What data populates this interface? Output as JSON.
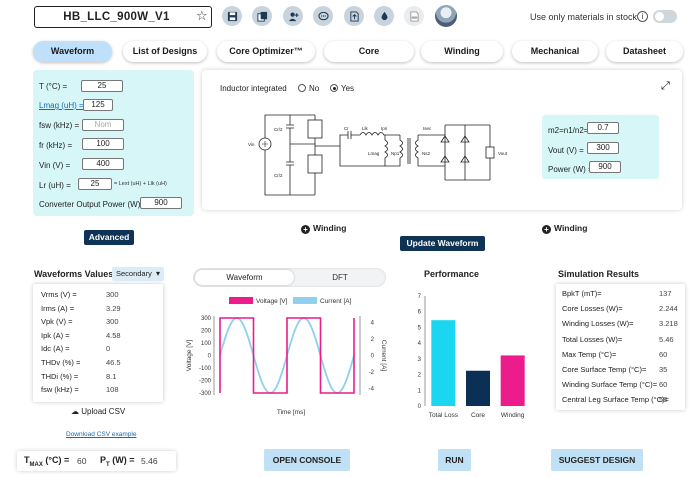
{
  "header": {
    "design_name": "HB_LLC_900W_V1",
    "stock_label": "Use only materials in stock",
    "stock_toggle_on": false,
    "toolbar_icons": [
      "save-icon",
      "copy-icon",
      "add-user-icon",
      "comment-icon",
      "export-icon",
      "drop-icon",
      "pdf-icon"
    ]
  },
  "tabs": [
    "Waveform",
    "List of Designs",
    "Core Optimizer™",
    "Core",
    "Winding",
    "Mechanical",
    "Datasheet"
  ],
  "active_tab": "Waveform",
  "params": {
    "t_label": "T (°C) =",
    "t_value": "25",
    "lmag_label": "Lmag (uH) =",
    "lmag_value": "125",
    "fsw_label": "fsw (kHz) =",
    "fsw_placeholder": "Nom",
    "fr_label": "fr (kHz) =",
    "fr_value": "100",
    "vin_label": "Vin (V) =",
    "vin_value": "400",
    "lr_label": "Lr (uH) =",
    "lr_value": "25",
    "lr_note": "= Lext (uH) + Llk (uH)",
    "pout_label": "Converter Output Power (W) =",
    "pout_value": "900",
    "advanced_label": "Advanced"
  },
  "schematic": {
    "inductor_label": "Inductor integrated",
    "no_label": "No",
    "yes_label": "Yes",
    "labels": {
      "vin": "Vin",
      "cr2a": "Cr/2",
      "cr2b": "Cr/2",
      "cr": "Cr",
      "llk": "Llk",
      "ipri": "Ipri",
      "lmag": "Lmag",
      "np1": "Np1",
      "isec": "Isec",
      "ns2": "Ns2",
      "vout": "Vout"
    },
    "ratio_label": "m2=n1/n2=",
    "ratio_value": "0.7",
    "vout_label": "Vout (V) =",
    "vout_value": "300",
    "power_label": "Power (W) =",
    "power_value": "900"
  },
  "winding_links": [
    "Winding",
    "Winding"
  ],
  "update_label": "Update Waveform",
  "waveform_values": {
    "title": "Waveforms Values",
    "selector": "Secondary",
    "rows": [
      {
        "label": "Vrms (V) =",
        "value": "300"
      },
      {
        "label": "Irms (A) =",
        "value": "3.29"
      },
      {
        "label": "Vpk (V) =",
        "value": "300"
      },
      {
        "label": "Ipk (A) =",
        "value": "4.58"
      },
      {
        "label": "Idc (A) =",
        "value": "0"
      },
      {
        "label": "THDv (%) =",
        "value": "46.5"
      },
      {
        "label": "THDi (%) =",
        "value": "8.1"
      },
      {
        "label": "fsw (kHz) =",
        "value": "108"
      }
    ],
    "upload_label": "Upload CSV",
    "download_label": "Download CSV example"
  },
  "view_toggle": {
    "waveform": "Waveform",
    "dft": "DFT"
  },
  "chart_data": [
    {
      "type": "line",
      "title": "",
      "legend": [
        "Voltage [V]",
        "Current [A]"
      ],
      "legend_position": "top",
      "xlabel": "Time [ms]",
      "ylabel": "Voltage [V]",
      "y2label": "Current [A]",
      "ylim": [
        -300,
        300
      ],
      "y2lim": [
        -4.58,
        4.58
      ],
      "yticks": [
        "300",
        "200",
        "100",
        "0",
        "-100",
        "-200",
        "-300"
      ],
      "y2ticks": [
        "4",
        "2",
        "0",
        "-2",
        "-4"
      ],
      "series": [
        {
          "name": "Voltage [V]",
          "color": "#ec1c8c",
          "shape": "square",
          "periods": 2,
          "amplitude": 300
        },
        {
          "name": "Current [A]",
          "color": "#8fd0ee",
          "shape": "sine",
          "periods": 2,
          "amplitude": 4.58
        }
      ]
    },
    {
      "type": "bar",
      "title": "Performance",
      "categories": [
        "Total Loss",
        "Core",
        "Winding"
      ],
      "values": [
        5.46,
        2.244,
        3.218
      ],
      "colors": [
        "#1ad6f0",
        "#0c2f55",
        "#ec1c8c"
      ],
      "ylim": [
        0,
        7
      ],
      "yticks": [
        "0",
        "1",
        "2",
        "3",
        "4",
        "5",
        "6",
        "7"
      ]
    }
  ],
  "simulation": {
    "title": "Simulation Results",
    "rows": [
      {
        "label": "BpkT (mT)=",
        "value": "137"
      },
      {
        "label": "Core Losses (W)=",
        "value": "2.244"
      },
      {
        "label": "Winding Losses (W)=",
        "value": "3.218"
      },
      {
        "label": "Total Losses (W)=",
        "value": "5.46"
      },
      {
        "label": "Max Temp (°C)=",
        "value": "60"
      },
      {
        "label": "Core Surface Temp (°C)=",
        "value": "35"
      },
      {
        "label": "Winding Surface Temp (°C)=",
        "value": "60"
      },
      {
        "label": "Central Leg Surface Temp (°C)=",
        "value": "58"
      }
    ]
  },
  "footer": {
    "tmax_main": "T",
    "tmax_sub": "MAX",
    "tmax_unit": "(°C) =",
    "tmax_value": "60",
    "pt_main": "P",
    "pt_sub": "T",
    "pt_unit": "(W) =",
    "pt_value": "5.46",
    "open_console": "OPEN CONSOLE",
    "run": "RUN",
    "suggest": "SUGGEST DESIGN"
  }
}
